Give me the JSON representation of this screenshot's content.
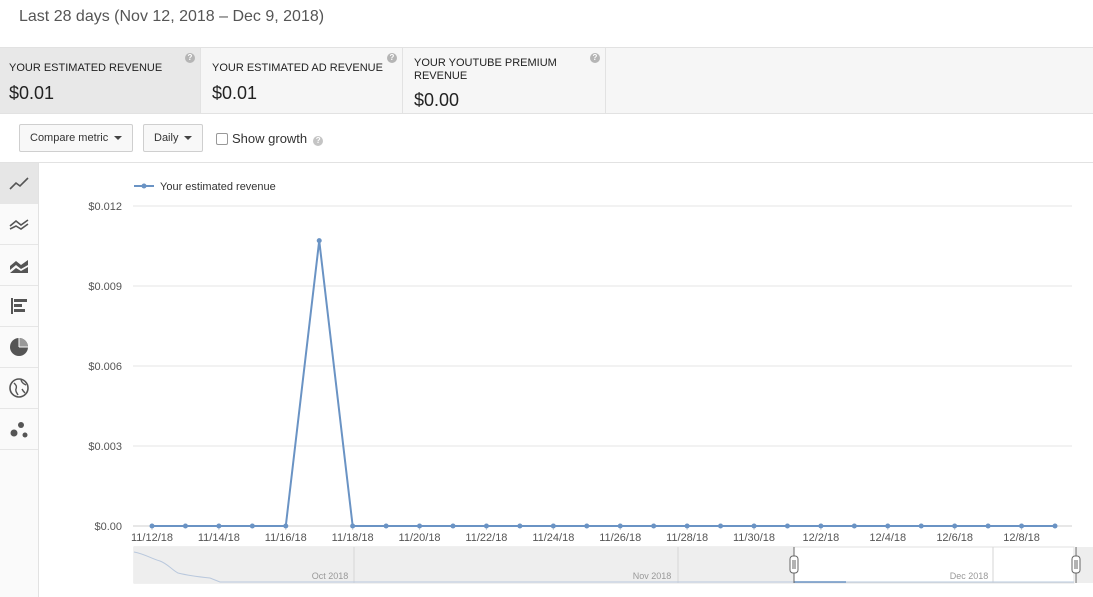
{
  "header": {
    "date_range": "Last 28 days (Nov 12, 2018 – Dec 9, 2018)"
  },
  "metrics": [
    {
      "title": "YOUR ESTIMATED REVENUE",
      "value": "$0.01",
      "active": true
    },
    {
      "title": "YOUR ESTIMATED AD REVENUE",
      "value": "$0.01",
      "active": false
    },
    {
      "title": "YOUR YOUTUBE PREMIUM REVENUE",
      "value": "$0.00",
      "active": false
    }
  ],
  "help_glyph": "?",
  "toolbar": {
    "compare_label": "Compare metric",
    "interval_label": "Daily",
    "show_growth_label": "Show growth"
  },
  "sidebar": {
    "items": [
      {
        "icon": "line-chart-icon",
        "active": true
      },
      {
        "icon": "multi-line-chart-icon",
        "active": false
      },
      {
        "icon": "stacked-area-chart-icon",
        "active": false
      },
      {
        "icon": "bar-chart-icon",
        "active": false
      },
      {
        "icon": "pie-chart-icon",
        "active": false
      },
      {
        "icon": "globe-icon",
        "active": false
      },
      {
        "icon": "bubble-chart-icon",
        "active": false
      }
    ]
  },
  "colors": {
    "series": "#6a93c4",
    "grid": "#e6e6e6",
    "axis_text": "#555555"
  },
  "chart_data": {
    "type": "line",
    "series": [
      {
        "name": "Your estimated revenue",
        "x": [
          "11/12/18",
          "11/13/18",
          "11/14/18",
          "11/15/18",
          "11/16/18",
          "11/17/18",
          "11/18/18",
          "11/19/18",
          "11/20/18",
          "11/21/18",
          "11/22/18",
          "11/23/18",
          "11/24/18",
          "11/25/18",
          "11/26/18",
          "11/27/18",
          "11/28/18",
          "11/29/18",
          "11/30/18",
          "12/1/18",
          "12/2/18",
          "12/3/18",
          "12/4/18",
          "12/5/18",
          "12/6/18",
          "12/7/18",
          "12/8/18",
          "12/9/18"
        ],
        "values": [
          0,
          0,
          0,
          0,
          0,
          0.0107,
          0,
          0,
          0,
          0,
          0,
          0,
          0,
          0,
          0,
          0,
          0,
          0,
          0,
          0,
          0,
          0,
          0,
          0,
          0,
          0,
          0,
          0
        ]
      }
    ],
    "x_tick_labels": [
      "11/12/18",
      "11/14/18",
      "11/16/18",
      "11/18/18",
      "11/20/18",
      "11/22/18",
      "11/24/18",
      "11/26/18",
      "11/28/18",
      "11/30/18",
      "12/2/18",
      "12/4/18",
      "12/6/18",
      "12/8/18"
    ],
    "y_tick_labels": [
      "$0.00",
      "$0.003",
      "$0.006",
      "$0.009",
      "$0.012"
    ],
    "ylim": [
      0,
      0.012
    ],
    "grid": true,
    "legend_position": "top-left",
    "navigator": {
      "labels": [
        "Oct 2018",
        "Nov 2018",
        "Dec 2018"
      ]
    }
  }
}
